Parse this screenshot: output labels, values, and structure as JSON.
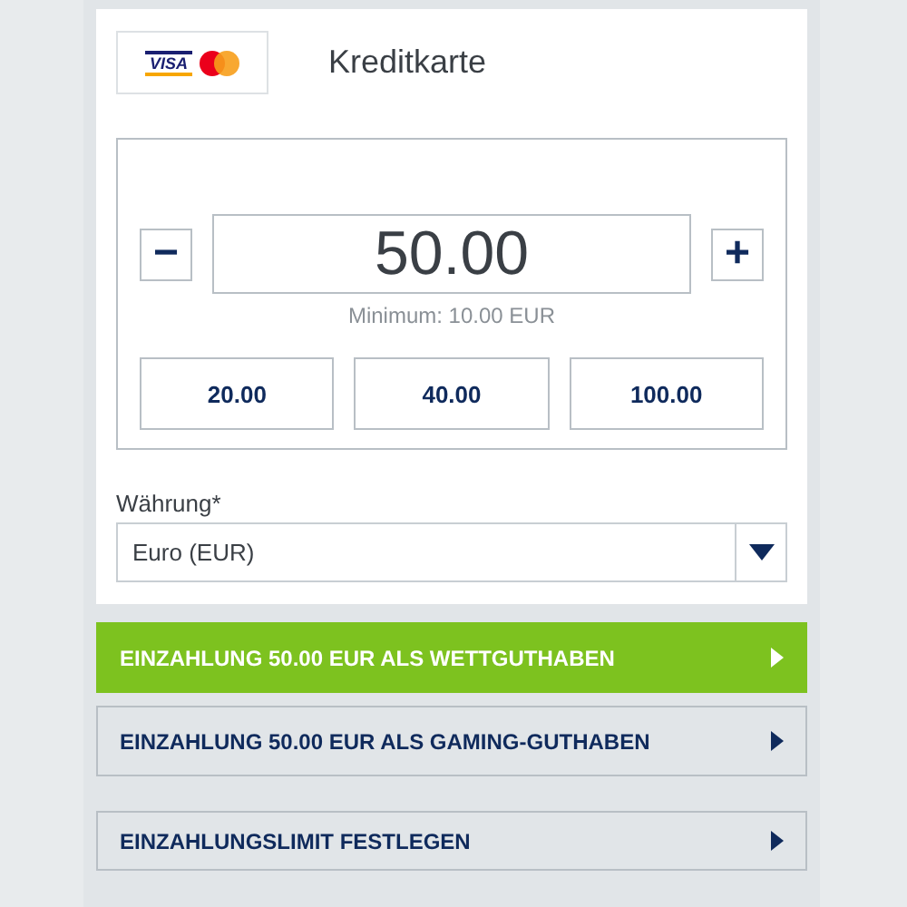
{
  "method": {
    "logo_text": "VISA",
    "title": "Kreditkarte"
  },
  "amount": {
    "minus": "−",
    "value": "50.00",
    "plus": "+",
    "hint": "Minimum: 10.00 EUR",
    "presets": [
      "20.00",
      "40.00",
      "100.00"
    ]
  },
  "currency": {
    "label": "Währung*",
    "value": "Euro (EUR)"
  },
  "actions": [
    {
      "label": "EINZAHLUNG 50.00 EUR ALS WETTGUTHABEN",
      "kind": "primary"
    },
    {
      "label": "EINZAHLUNG 50.00 EUR ALS GAMING-GUTHABEN",
      "kind": "secondary"
    },
    {
      "label": "EINZAHLUNGSLIMIT FESTLEGEN",
      "kind": "secondary"
    }
  ]
}
